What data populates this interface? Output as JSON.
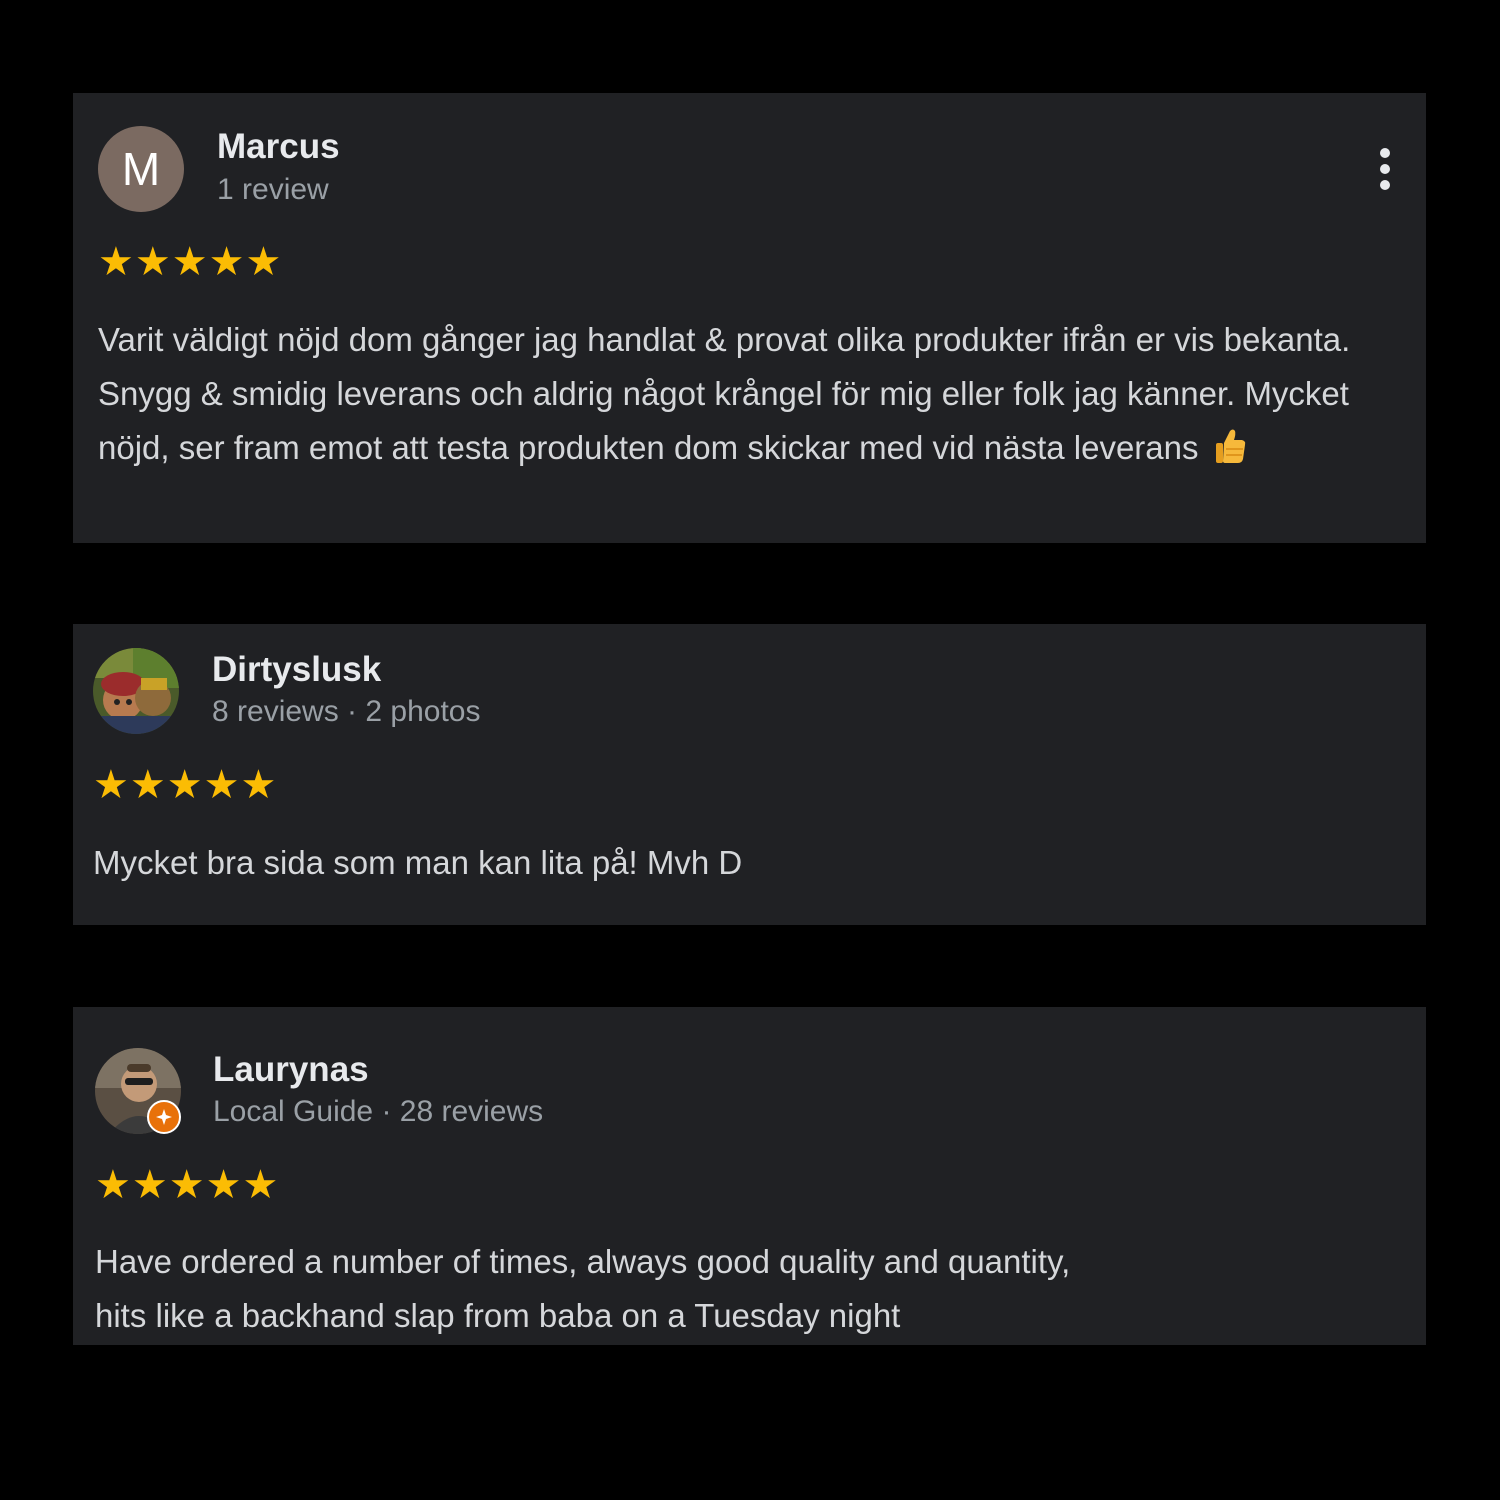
{
  "reviews": [
    {
      "name": "Marcus",
      "avatar_letter": "M",
      "meta": "1 review",
      "rating": 5,
      "text": "Varit väldigt nöjd dom gånger jag handlat & provat olika produkter ifrån er vis bekanta. Snygg & smidig leverans och aldrig något krångel för mig eller folk jag känner. Mycket nöjd, ser fram emot att testa produkten dom skickar med vid nästa leverans",
      "text_emoji": "thumbs-up-icon"
    },
    {
      "name": "Dirtyslusk",
      "meta": "8 reviews · 2 photos",
      "rating": 5,
      "text": "Mycket bra sida som man kan lita på! Mvh D"
    },
    {
      "name": "Laurynas",
      "meta": "Local Guide · 28 reviews",
      "rating": 5,
      "text_line1": "Have ordered a number of times, always good quality and quantity,",
      "text_line2": "hits like a backhand slap from baba on a Tuesday night"
    }
  ],
  "star_glyph": "★",
  "colors": {
    "page_bg": "#000000",
    "card_bg": "#202124",
    "star": "#fbbc04",
    "name": "#e8eaed",
    "meta": "#9aa0a6",
    "local_guide_badge": "#e8710a"
  }
}
